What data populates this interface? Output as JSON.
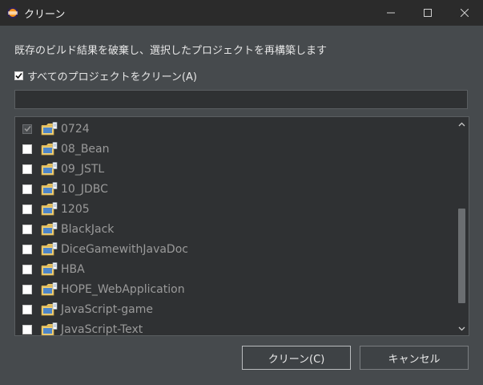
{
  "window": {
    "title": "クリーン",
    "icon": "eclipse-icon",
    "controls": [
      "minimize-icon",
      "maximize-icon",
      "close-icon"
    ]
  },
  "description": "既存のビルド結果を破棄し、選択したプロジェクトを再構築します",
  "clean_all": {
    "label": "すべてのプロジェクトをクリーン(A)",
    "checked": true
  },
  "filter": {
    "value": "",
    "placeholder": ""
  },
  "projects": [
    {
      "name": "0724",
      "checked": true
    },
    {
      "name": "08_Bean",
      "checked": false
    },
    {
      "name": "09_JSTL",
      "checked": false
    },
    {
      "name": "10_JDBC",
      "checked": false
    },
    {
      "name": "1205",
      "checked": false
    },
    {
      "name": "BlackJack",
      "checked": false
    },
    {
      "name": "DiceGamewithJavaDoc",
      "checked": false
    },
    {
      "name": "HBA",
      "checked": false
    },
    {
      "name": "HOPE_WebApplication",
      "checked": false
    },
    {
      "name": "JavaScript-game",
      "checked": false
    },
    {
      "name": "JavaScript-Text",
      "checked": false
    }
  ],
  "buttons": {
    "clean": "クリーン(C)",
    "cancel": "キャンセル"
  },
  "colors": {
    "background": "#464a4d",
    "titlebar": "#2b2b2b",
    "list_bg": "#2f3133",
    "disabled_text": "#9a9a9a"
  }
}
